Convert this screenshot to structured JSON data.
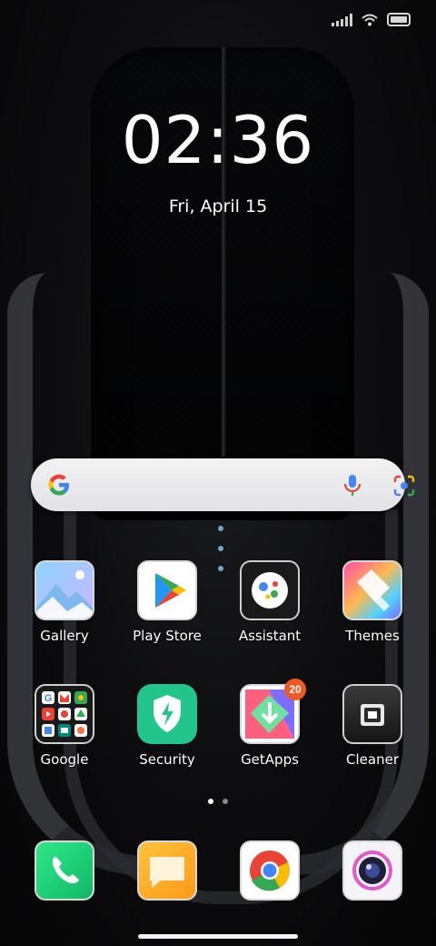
{
  "status_bar": {
    "signal_icon": "signal-bars-icon",
    "wifi_icon": "wifi-icon",
    "battery_icon": "battery-icon"
  },
  "clock": {
    "time": "02:36",
    "date": "Fri, April 15"
  },
  "search_bar": {
    "google_icon": "google-g-icon",
    "mic_icon": "microphone-icon",
    "lens_icon": "google-lens-icon"
  },
  "apps": [
    {
      "name": "Gallery",
      "icon": "gallery-icon"
    },
    {
      "name": "Play Store",
      "icon": "play-store-icon"
    },
    {
      "name": "Assistant",
      "icon": "assistant-icon"
    },
    {
      "name": "Themes",
      "icon": "themes-icon"
    },
    {
      "name": "Google",
      "icon": "google-folder-icon"
    },
    {
      "name": "Security",
      "icon": "security-shield-icon"
    },
    {
      "name": "GetApps",
      "icon": "getapps-icon",
      "badge": "20"
    },
    {
      "name": "Cleaner",
      "icon": "cleaner-icon"
    }
  ],
  "dock": [
    {
      "icon": "phone-icon"
    },
    {
      "icon": "messages-icon"
    },
    {
      "icon": "chrome-icon"
    },
    {
      "icon": "camera-icon"
    }
  ],
  "page_indicator": {
    "pages": 2,
    "current": 1
  },
  "colors": {
    "badge": "#ee5a24",
    "security_bg": "#22c58b",
    "phone_bg": "#1fd37a",
    "messages_bg": "#ffb31a"
  }
}
